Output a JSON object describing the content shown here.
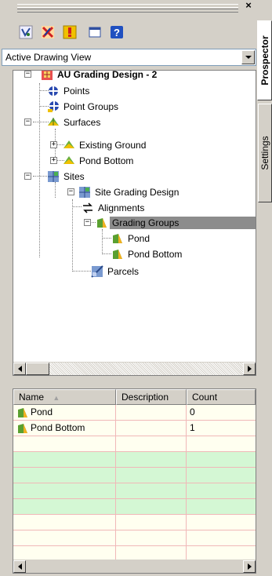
{
  "window": {
    "close_symbol": "×"
  },
  "toolbar": {
    "buttons": [
      {
        "name": "prospector-mode-icon",
        "icon": "pipeline-network"
      },
      {
        "name": "item-view-icon",
        "icon": "red-cross-pencil"
      },
      {
        "name": "warning-icon",
        "icon": "event-warning"
      },
      {
        "name": "panorama-icon",
        "icon": "window"
      },
      {
        "name": "help-icon",
        "icon": "question-mark"
      }
    ]
  },
  "view_select": {
    "value": "Active Drawing View"
  },
  "tree": {
    "root": "AU Grading Design - 2",
    "points": "Points",
    "point_groups": "Point Groups",
    "surfaces": "Surfaces",
    "existing_ground": "Existing Ground",
    "pond_bottom_surface": "Pond Bottom",
    "sites": "Sites",
    "site_grading": "Site Grading Design",
    "alignments": "Alignments",
    "grading_groups": "Grading Groups",
    "pond": "Pond",
    "pond_bottom": "Pond Bottom",
    "parcels": "Parcels"
  },
  "list": {
    "columns": [
      "Name",
      "Description",
      "Count"
    ],
    "sort_symbol": "▲",
    "rows": [
      {
        "name": "Pond",
        "description": "",
        "count": "0"
      },
      {
        "name": "Pond Bottom",
        "description": "",
        "count": "1"
      }
    ]
  },
  "tabs": {
    "prospector": "Prospector",
    "settings": "Settings"
  },
  "colors": {
    "selection": "#8c8c8c",
    "row_highlight": "#d4f7d4",
    "row_cream": "#fffff0",
    "grid_line": "#f0b8b8"
  }
}
